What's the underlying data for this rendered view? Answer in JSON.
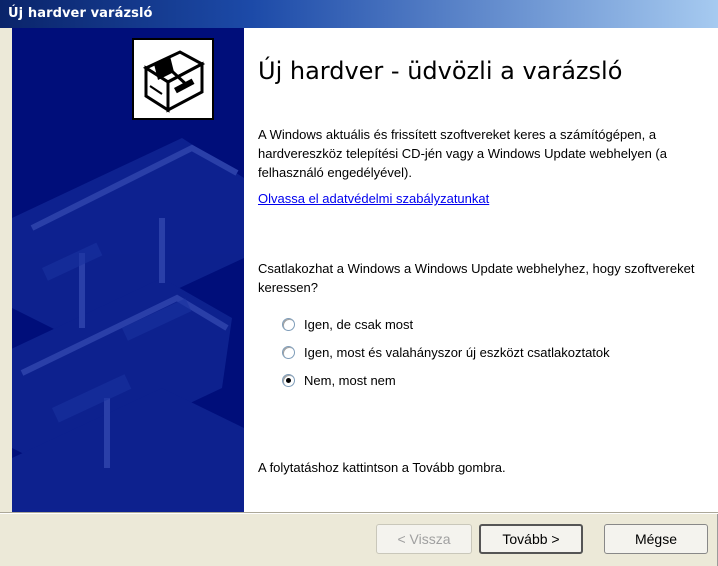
{
  "window": {
    "title": "Új hardver varázsló"
  },
  "banner": {
    "icon": "hardware-box-icon",
    "background": "#000e7a"
  },
  "content": {
    "heading": "Új hardver - üdvözli a varázsló",
    "intro": "A Windows aktuális és frissített szoftvereket keres a számítógépen, a hardvereszköz telepítési CD-jén vagy a Windows Update webhelyen (a felhasználó engedélyével).",
    "privacy_link": "Olvassa el adatvédelmi szabályzatunkat",
    "question": "Csatlakozhat a Windows a Windows Update webhelyhez, hogy szoftvereket keressen?",
    "options": [
      {
        "label": "Igen, de csak most",
        "selected": false
      },
      {
        "label": "Igen, most és valahányszor új eszközt csatlakoztatok",
        "selected": false
      },
      {
        "label": "Nem, most nem",
        "selected": true
      }
    ],
    "continue_hint": "A folytatáshoz kattintson a Tovább gombra."
  },
  "buttons": {
    "back": "< Vissza",
    "next": "Tovább >",
    "cancel": "Mégse"
  }
}
